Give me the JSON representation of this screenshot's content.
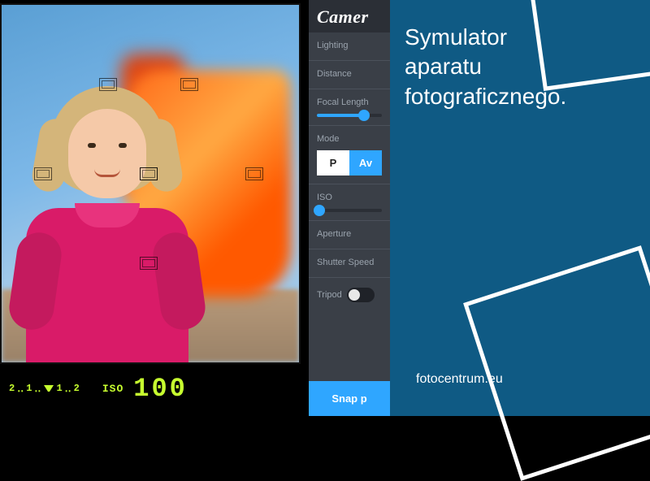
{
  "panel": {
    "title": "Camer",
    "lighting_label": "Lighting",
    "distance_label": "Distance",
    "focal_label": "Focal Length",
    "mode_label": "Mode",
    "mode_p": "P",
    "mode_av": "Av",
    "iso_label": "ISO",
    "aperture_label": "Aperture",
    "shutter_label": "Shutter Speed",
    "tripod_label": "Tripod",
    "snap_label": "Snap p"
  },
  "viewfinder": {
    "iso_label": "ISO",
    "iso_value": "100",
    "exposure_scale": [
      "2",
      "‥",
      "1",
      "‥",
      "1",
      "‥",
      "2"
    ]
  },
  "promo": {
    "title_line1": "Symulator",
    "title_line2": "aparatu",
    "title_line3": "fotograficznego.",
    "site": "fotocentrum.eu"
  },
  "sliders": {
    "focal_pct": 72,
    "iso_pct": 4
  }
}
